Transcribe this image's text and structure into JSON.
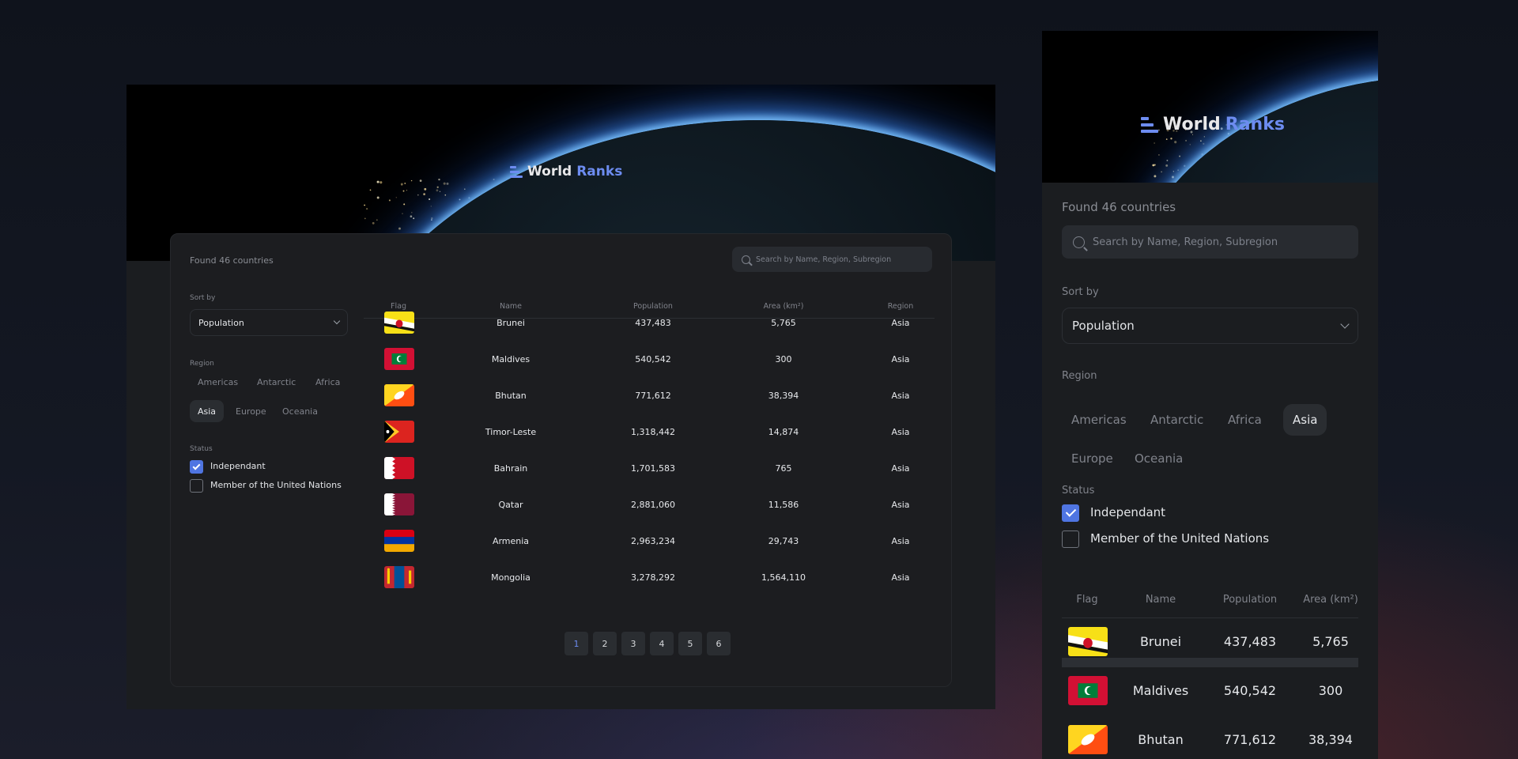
{
  "brand": {
    "word1": "World",
    "word2": "Ranks"
  },
  "summary": {
    "found_text": "Found 46 countries"
  },
  "search": {
    "placeholder": "Search by Name, Region, Subregion"
  },
  "sort": {
    "label": "Sort by",
    "selected": "Population"
  },
  "region": {
    "label": "Region",
    "options": [
      "Americas",
      "Antarctic",
      "Africa",
      "Asia",
      "Europe",
      "Oceania"
    ],
    "active": "Asia"
  },
  "status": {
    "label": "Status",
    "options": [
      {
        "label": "Independant",
        "checked": true
      },
      {
        "label": "Member of the United Nations",
        "checked": false
      }
    ]
  },
  "table": {
    "columns": [
      "Flag",
      "Name",
      "Population",
      "Area (km²)",
      "Region"
    ],
    "rows": [
      {
        "flag": "brunei-flag",
        "name": "Brunei",
        "population": "437,483",
        "area": "5,765",
        "region": "Asia"
      },
      {
        "flag": "maldives-flag",
        "name": "Maldives",
        "population": "540,542",
        "area": "300",
        "region": "Asia"
      },
      {
        "flag": "bhutan-flag",
        "name": "Bhutan",
        "population": "771,612",
        "area": "38,394",
        "region": "Asia"
      },
      {
        "flag": "timor-leste-flag",
        "name": "Timor-Leste",
        "population": "1,318,442",
        "area": "14,874",
        "region": "Asia"
      },
      {
        "flag": "bahrain-flag",
        "name": "Bahrain",
        "population": "1,701,583",
        "area": "765",
        "region": "Asia"
      },
      {
        "flag": "qatar-flag",
        "name": "Qatar",
        "population": "2,881,060",
        "area": "11,586",
        "region": "Asia"
      },
      {
        "flag": "armenia-flag",
        "name": "Armenia",
        "population": "2,963,234",
        "area": "29,743",
        "region": "Asia"
      },
      {
        "flag": "mongolia-flag",
        "name": "Mongolia",
        "population": "3,278,292",
        "area": "1,564,110",
        "region": "Asia"
      }
    ]
  },
  "pagination": {
    "pages": [
      "1",
      "2",
      "3",
      "4",
      "5",
      "6"
    ],
    "current": "1"
  },
  "colors": {
    "accent": "#6d8cf0",
    "checkbox": "#4f75e2",
    "panel": "#1c1d20"
  }
}
